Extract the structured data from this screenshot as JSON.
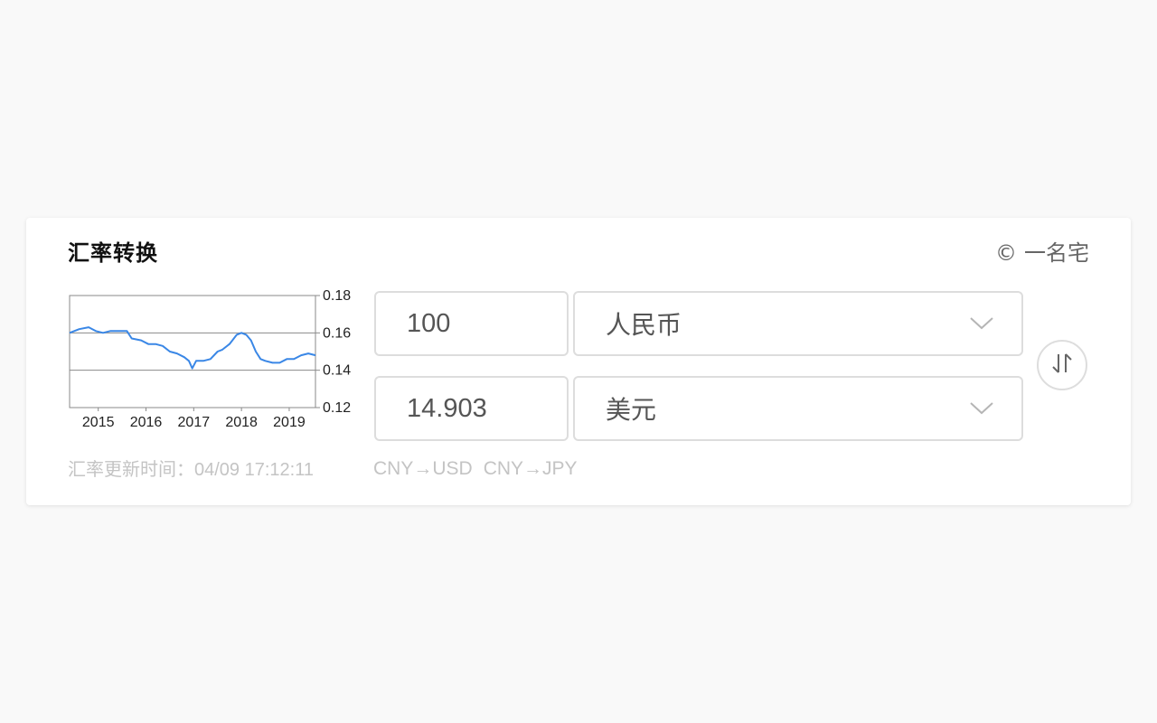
{
  "widget": {
    "title": "汇率转换",
    "brand_symbol": "©",
    "brand_name": "一名宅"
  },
  "converter": {
    "from_amount": "100",
    "from_currency": "人民币",
    "to_amount": "14.903",
    "to_currency": "美元"
  },
  "footer": {
    "update_label": "汇率更新时间：",
    "update_time": "04/09 17:12:11",
    "links": [
      "CNY→USD",
      "CNY→JPY"
    ]
  },
  "icons": {
    "chevron": "chevron-down-icon",
    "swap": "swap-vertical-icon"
  },
  "colors": {
    "line": "#3a87e6",
    "axis": "#8a8a8a",
    "grid": "#8a8a8a",
    "border": "#dddddd"
  },
  "chart_data": {
    "type": "line",
    "title": "",
    "xlabel": "",
    "ylabel": "",
    "x_ticks": [
      "2015",
      "2016",
      "2017",
      "2018",
      "2019"
    ],
    "y_ticks": [
      "0.18",
      "0.16",
      "0.14",
      "0.12"
    ],
    "ylim": [
      0.12,
      0.18
    ],
    "xlim": [
      2014.4,
      2019.55
    ],
    "grid": "horizontal at 0.16 and 0.14",
    "series": [
      {
        "x": [
          2014.4,
          2014.6,
          2014.8,
          2014.95,
          2015.1,
          2015.25,
          2015.45,
          2015.6,
          2015.7,
          2015.9,
          2016.05,
          2016.2,
          2016.35,
          2016.5,
          2016.65,
          2016.8,
          2016.9,
          2016.97,
          2017.05,
          2017.2,
          2017.35,
          2017.5,
          2017.6,
          2017.75,
          2017.9,
          2018.0,
          2018.1,
          2018.2,
          2018.3,
          2018.4,
          2018.5,
          2018.65,
          2018.8,
          2018.95,
          2019.1,
          2019.25,
          2019.4,
          2019.55
        ],
        "y": [
          0.16,
          0.162,
          0.163,
          0.161,
          0.16,
          0.161,
          0.161,
          0.161,
          0.157,
          0.156,
          0.154,
          0.154,
          0.153,
          0.15,
          0.149,
          0.147,
          0.145,
          0.141,
          0.145,
          0.145,
          0.146,
          0.15,
          0.151,
          0.154,
          0.159,
          0.16,
          0.159,
          0.156,
          0.15,
          0.146,
          0.145,
          0.144,
          0.144,
          0.146,
          0.146,
          0.148,
          0.149,
          0.148
        ]
      }
    ]
  }
}
